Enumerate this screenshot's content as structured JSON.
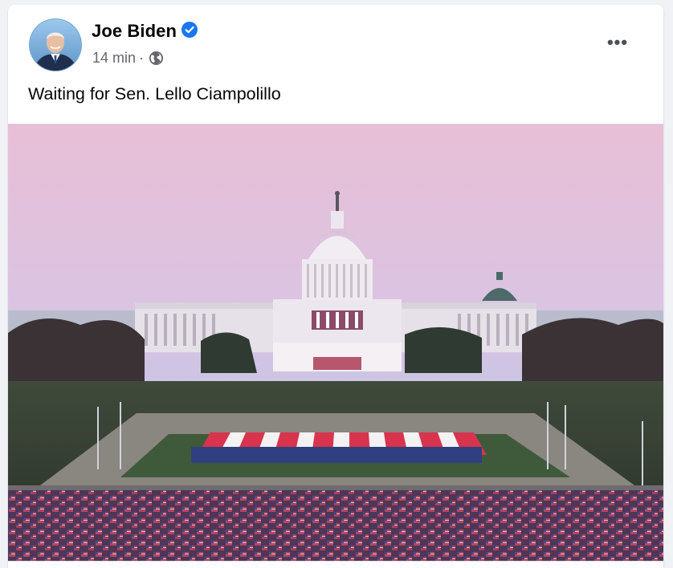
{
  "post": {
    "author": {
      "name": "Joe Biden",
      "verified": true,
      "avatar_icon": "profile-photo"
    },
    "meta": {
      "time": "14 min",
      "separator": "·",
      "audience_icon": "globe-icon"
    },
    "more_icon": "more-options-icon",
    "text": "Waiting for Sen. Lello Ciampolillo",
    "photo": {
      "subject": "US Capitol at dusk with flags on the National Mall"
    }
  },
  "colors": {
    "verified_blue": "#1877f2",
    "secondary_text": "#65676b",
    "primary_text": "#050505"
  }
}
